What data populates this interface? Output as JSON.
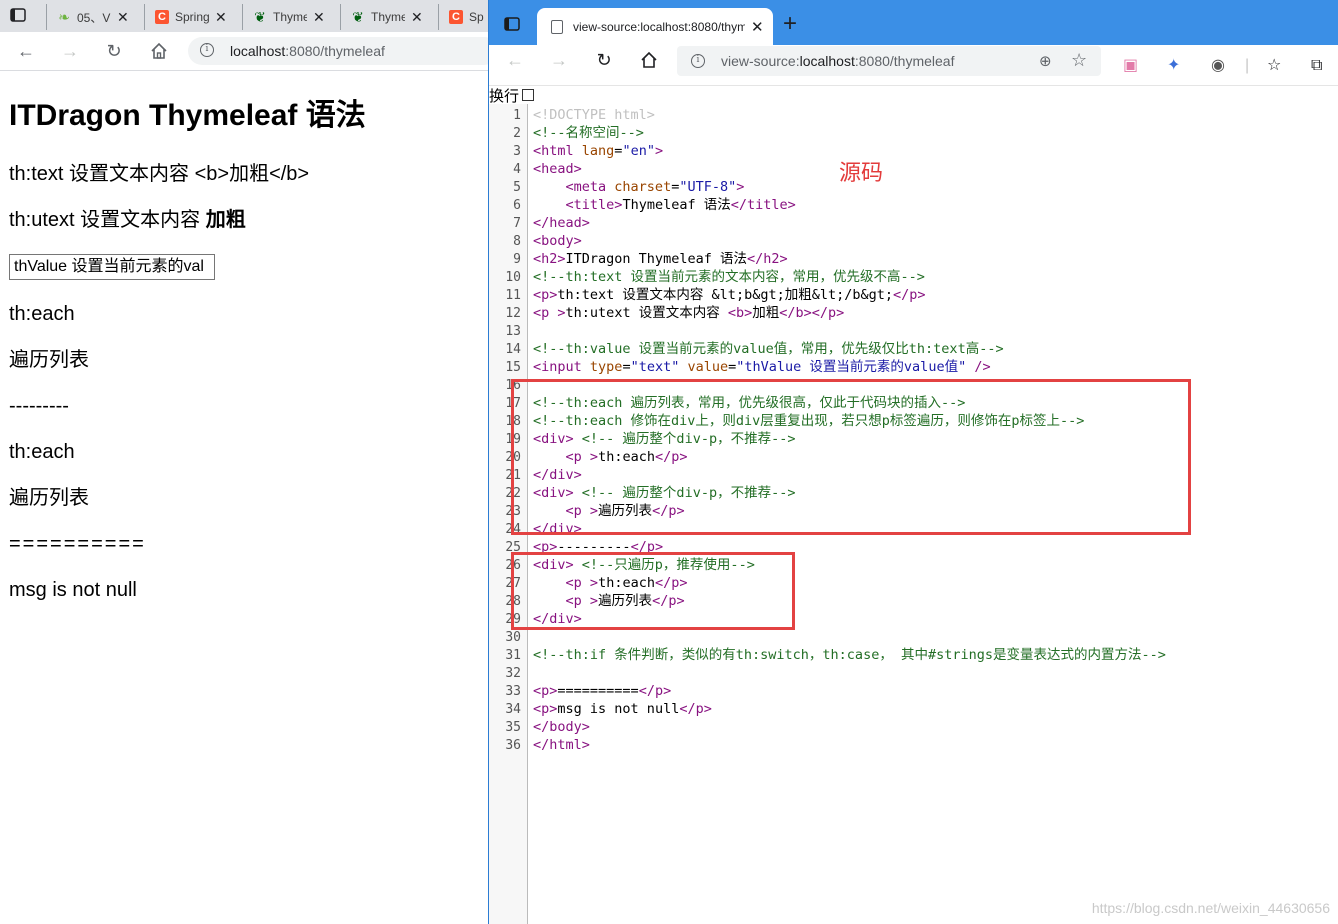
{
  "left_browser": {
    "tabs": [
      {
        "title": "05、V",
        "favicon": "spring-leaf-icon",
        "color": "#6db33f"
      },
      {
        "title": "Spring",
        "favicon": "csdn-c-icon",
        "color": "#fc5531"
      },
      {
        "title": "Thyme",
        "favicon": "thymeleaf-icon",
        "color": "#005f0f"
      },
      {
        "title": "Thyme",
        "favicon": "thymeleaf-icon",
        "color": "#005f0f"
      },
      {
        "title": "Sp",
        "favicon": "csdn-c-icon",
        "color": "#fc5531"
      }
    ],
    "address_host": "localhost",
    "address_rest": ":8080/thymeleaf",
    "content": {
      "h1": "ITDragon Thymeleaf 语法",
      "p_text": "th:text 设置文本内容 <b>加粗</b>",
      "p_utext_prefix": "th:utext 设置文本内容 ",
      "p_utext_bold": "加粗",
      "input_value": "thValue 设置当前元素的val",
      "each1": "th:each",
      "list1": "遍历列表",
      "dashes": "---------",
      "each2": "th:each",
      "list2": "遍历列表",
      "equals": "==========",
      "msg": "msg is not null"
    }
  },
  "right_browser": {
    "tab_title": "view-source:localhost:8080/thym",
    "address_prefix": "view-source:",
    "address_host": "localhost",
    "address_rest": ":8080/thymeleaf",
    "wrap_label": "换行",
    "annotation": "源码",
    "watermark": "https://blog.csdn.net/weixin_44630656",
    "source_lines": [
      "<!DOCTYPE html>",
      "<!--名称空间-->",
      "<html lang=\"en\">",
      "<head>",
      "    <meta charset=\"UTF-8\">",
      "    <title>Thymeleaf 语法</title>",
      "</head>",
      "<body>",
      "<h2>ITDragon Thymeleaf 语法</h2>",
      "<!--th:text 设置当前元素的文本内容，常用，优先级不高-->",
      "<p>th:text 设置文本内容 &lt;b&gt;加粗&lt;/b&gt;</p>",
      "<p >th:utext 设置文本内容 <b>加粗</b></p>",
      "",
      "<!--th:value 设置当前元素的value值，常用，优先级仅比th:text高-->",
      "<input type=\"text\" value=\"thValue 设置当前元素的value值\" />",
      "",
      "<!--th:each 遍历列表，常用，优先级很高，仅此于代码块的插入-->",
      "<!--th:each 修饰在div上，则div层重复出现，若只想p标签遍历，则修饰在p标签上-->",
      "<div> <!-- 遍历整个div-p，不推荐-->",
      "    <p >th:each</p>",
      "</div>",
      "<div> <!-- 遍历整个div-p，不推荐-->",
      "    <p >遍历列表</p>",
      "</div>",
      "<p>---------</p>",
      "<div> <!--只遍历p，推荐使用-->",
      "    <p >th:each</p>",
      "    <p >遍历列表</p>",
      "</div>",
      "",
      "<!--th:if 条件判断，类似的有th:switch，th:case， 其中#strings是变量表达式的内置方法-->",
      "",
      "<p>==========</p>",
      "<p>msg is not null</p>",
      "</body>",
      "</html>"
    ]
  },
  "colors": {
    "tag": "#881280",
    "attr_name": "#994500",
    "attr_value": "#1a1aa6",
    "comment": "#236e25",
    "doctype": "#c0c0c0",
    "highlight_box": "#e34242",
    "edge_tabstrip": "#3b8fe6"
  }
}
